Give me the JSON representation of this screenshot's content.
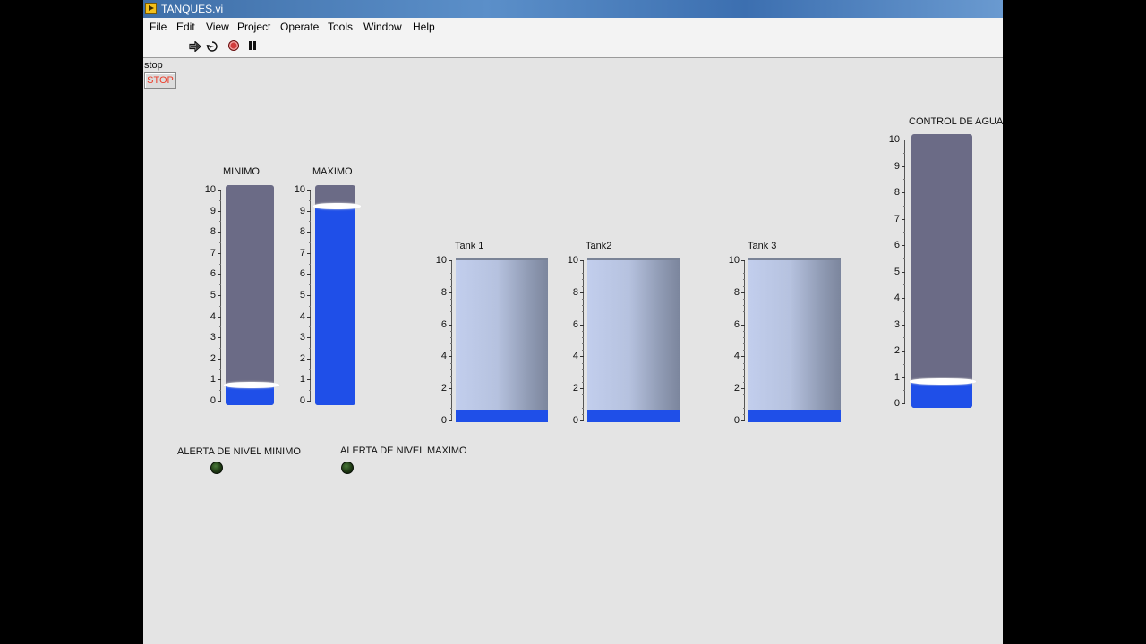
{
  "window": {
    "title": "TANQUES.vi"
  },
  "menu": [
    "File",
    "Edit",
    "View",
    "Project",
    "Operate",
    "Tools",
    "Window",
    "Help"
  ],
  "toolbar": {
    "run": "run-arrow-icon",
    "run_continuously": "run-continuously-icon",
    "abort": "abort-icon",
    "pause": "pause-icon"
  },
  "stop": {
    "label": "stop",
    "button": "STOP"
  },
  "sliders": [
    {
      "label": "MINIMO",
      "value": 0.7,
      "min": 0,
      "max": 10,
      "ticks": [
        "0",
        "1",
        "2",
        "3",
        "4",
        "5",
        "6",
        "7",
        "8",
        "9",
        "10"
      ]
    },
    {
      "label": "MAXIMO",
      "value": 9.2,
      "min": 0,
      "max": 10,
      "ticks": [
        "0",
        "1",
        "2",
        "3",
        "4",
        "5",
        "6",
        "7",
        "8",
        "9",
        "10"
      ]
    }
  ],
  "tanks": [
    {
      "label": "Tank 1",
      "value": 0.8,
      "min": 0,
      "max": 10,
      "ticks": [
        "0",
        "2",
        "4",
        "6",
        "8",
        "10"
      ]
    },
    {
      "label": "Tank2",
      "value": 0.8,
      "min": 0,
      "max": 10,
      "ticks": [
        "0",
        "2",
        "4",
        "6",
        "8",
        "10"
      ]
    },
    {
      "label": "Tank 3",
      "value": 0.8,
      "min": 0,
      "max": 10,
      "ticks": [
        "0",
        "2",
        "4",
        "6",
        "8",
        "10"
      ]
    }
  ],
  "control": {
    "label": "CONTROL DE AGUA",
    "value": 0.8,
    "min": 0,
    "max": 10,
    "ticks": [
      "0",
      "1",
      "2",
      "3",
      "4",
      "5",
      "6",
      "7",
      "8",
      "9",
      "10"
    ]
  },
  "alerts": [
    {
      "label": "ALERTA DE NIVEL MINIMO",
      "state": "off"
    },
    {
      "label": "ALERTA DE NIVEL MAXIMO",
      "state": "off"
    }
  ],
  "colors": {
    "fill": "#1f4fe8",
    "track": "#6b6b86",
    "stop_text": "#ec3d2b"
  }
}
